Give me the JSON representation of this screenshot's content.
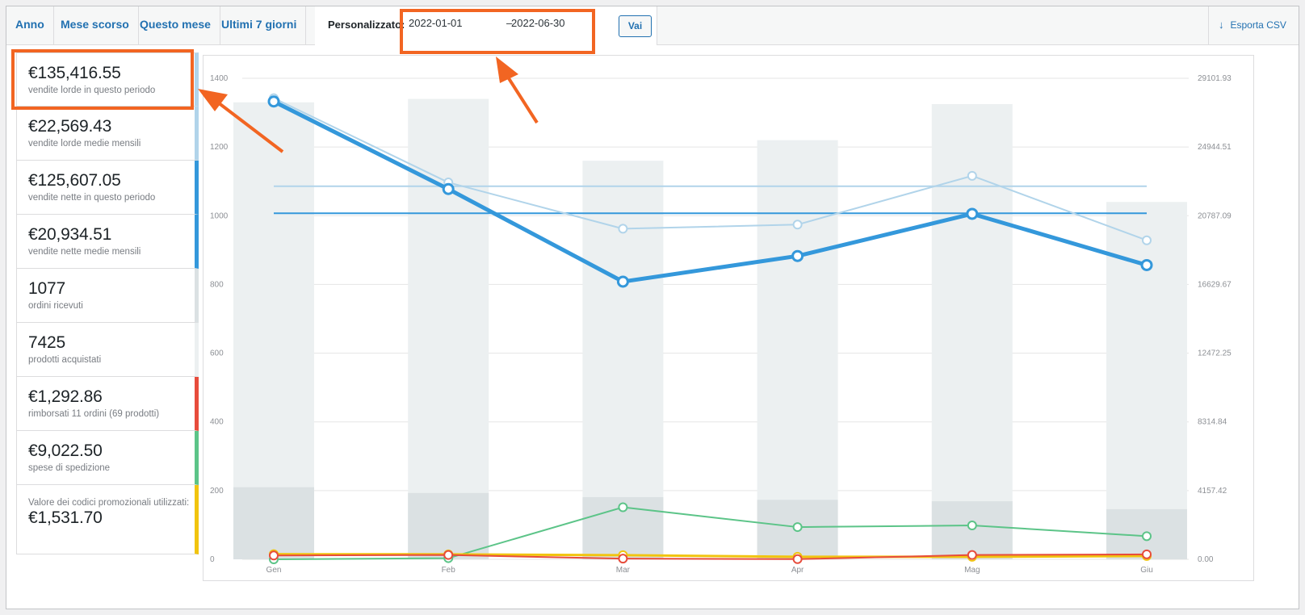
{
  "range_tabs": [
    {
      "label": "Anno"
    },
    {
      "label": "Mese scorso"
    },
    {
      "label": "Questo mese"
    },
    {
      "label": "Ultimi 7 giorni"
    }
  ],
  "custom_range": {
    "label": "Personalizzato:",
    "start_date": "2022-01-01",
    "separator": "–",
    "end_date": "2022-06-30",
    "go_label": "Vai"
  },
  "export": {
    "icon": "download-arrow-icon",
    "label": "Esporta CSV"
  },
  "legend": [
    {
      "amount": "€135,416.55",
      "desc": "vendite lorde in questo periodo",
      "color": "#b1d4ea"
    },
    {
      "amount": "€22,569.43",
      "desc": "vendite lorde medie mensili",
      "color": "#b1d4ea"
    },
    {
      "amount": "€125,607.05",
      "desc": "vendite nette in questo periodo",
      "color": "#3498db"
    },
    {
      "amount": "€20,934.51",
      "desc": "vendite nette medie mensili",
      "color": "#3498db"
    },
    {
      "amount": "1077",
      "desc": "ordini ricevuti",
      "color": "#dbe1e3"
    },
    {
      "amount": "7425",
      "desc": "prodotti acquistati",
      "color": "#ecf0f1"
    },
    {
      "amount": "€1,292.86",
      "desc": "rimborsati 11 ordini (69 prodotti)",
      "color": "#e74c3c"
    },
    {
      "amount": "€9,022.50",
      "desc": "spese di spedizione",
      "color": "#5cc488"
    },
    {
      "amount": "€1,531.70",
      "desc": "Valore dei codici promozionali utilizzati:",
      "color": "#f1c40f"
    }
  ],
  "colors": {
    "accent_link": "#2271b1",
    "annotation": "#f26522",
    "gross_sales": "#b1d4ea",
    "net_sales": "#3498db",
    "orders_bar": "#dbe1e3",
    "items_bar": "#ecf0f1",
    "refunds": "#e74c3c",
    "shipping": "#5cc488",
    "coupons": "#f1c40f"
  },
  "chart_data": {
    "type": "bar",
    "categories": [
      "Gen",
      "Feb",
      "Mar",
      "Apr",
      "Mag",
      "Giu"
    ],
    "y_left_ticks": [
      "0",
      "200",
      "400",
      "600",
      "800",
      "1000",
      "1200",
      "1400"
    ],
    "y_left_range": [
      0,
      1400
    ],
    "y_right_ticks": [
      "0.00",
      "4157.42",
      "8314.84",
      "12472.25",
      "16629.67",
      "20787.09",
      "24944.51",
      "29101.93"
    ],
    "y_right_range": [
      0,
      29101.93
    ],
    "grid": true,
    "series": [
      {
        "axis": "left",
        "kind": "bar",
        "color": "#ecf0f1",
        "values": [
          1330,
          1340,
          1160,
          1220,
          1325,
          1040
        ]
      },
      {
        "axis": "left",
        "kind": "bar",
        "color": "#dbe1e3",
        "values": [
          210,
          193,
          181,
          173,
          169,
          146
        ]
      },
      {
        "axis": "right",
        "kind": "line",
        "color": "#b1d4ea",
        "width": 2,
        "values": [
          27900,
          22800,
          20000,
          20250,
          23200,
          19300
        ]
      },
      {
        "axis": "right",
        "kind": "line",
        "color": "#3498db",
        "width": 5,
        "values": [
          27700,
          22400,
          16800,
          18350,
          20900,
          17800
        ]
      },
      {
        "axis": "right",
        "kind": "hline",
        "color": "#b1d4ea",
        "value": 22569.43
      },
      {
        "axis": "right",
        "kind": "hline",
        "color": "#3498db",
        "value": 20934.51
      },
      {
        "axis": "right",
        "kind": "line",
        "color": "#5cc488",
        "width": 2,
        "values": [
          0,
          70,
          3150,
          1950,
          2050,
          1400
        ]
      },
      {
        "axis": "right",
        "kind": "line",
        "color": "#f1c40f",
        "width": 3,
        "values": [
          310,
          300,
          250,
          150,
          150,
          200
        ]
      },
      {
        "axis": "right",
        "kind": "line",
        "color": "#e74c3c",
        "width": 2,
        "values": [
          230,
          260,
          40,
          10,
          260,
          300
        ]
      }
    ]
  }
}
